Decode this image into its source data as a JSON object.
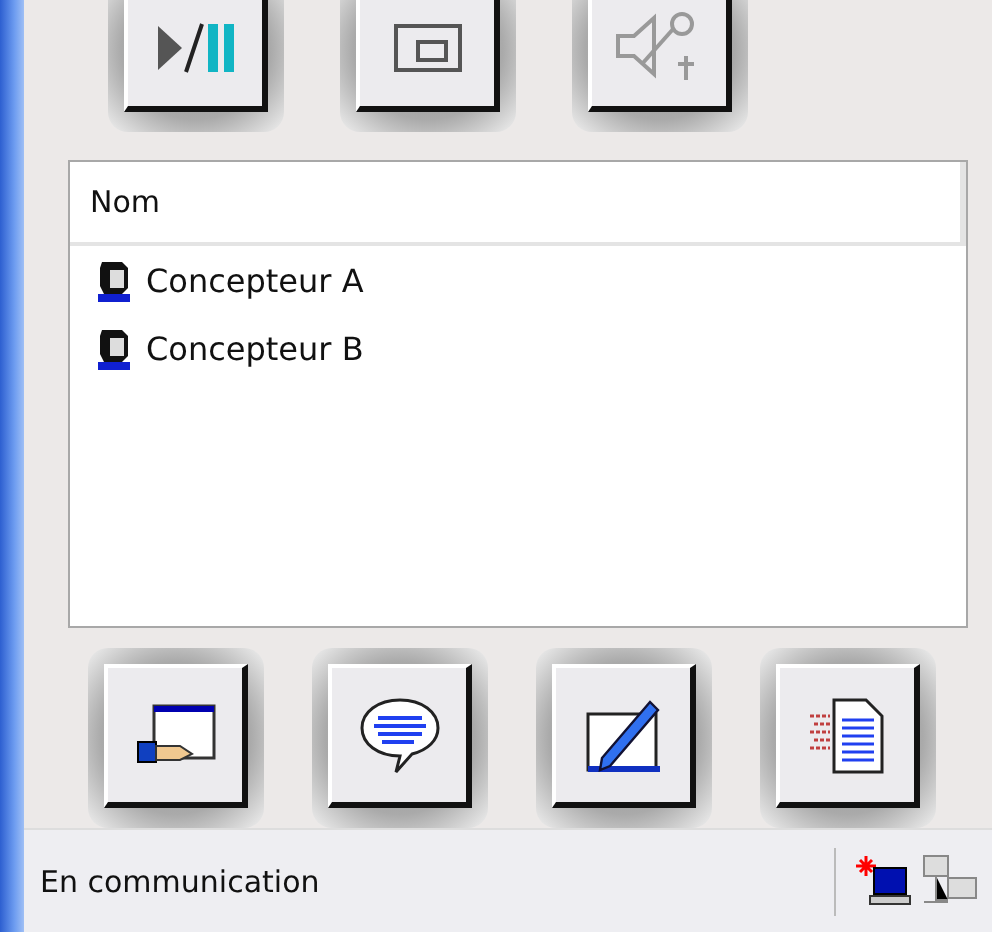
{
  "top_toolbar": [
    {
      "kind": "play-pause",
      "disabled": false
    },
    {
      "kind": "window",
      "disabled": false
    },
    {
      "kind": "audio",
      "disabled": true
    }
  ],
  "list": {
    "columns": [
      "Nom"
    ],
    "rows": [
      {
        "name": "Concepteur A"
      },
      {
        "name": "Concepteur B"
      }
    ]
  },
  "bottom_toolbar": [
    {
      "kind": "share"
    },
    {
      "kind": "chat"
    },
    {
      "kind": "whiteboard"
    },
    {
      "kind": "transfer"
    }
  ],
  "status_bar": {
    "text": "En communication"
  }
}
